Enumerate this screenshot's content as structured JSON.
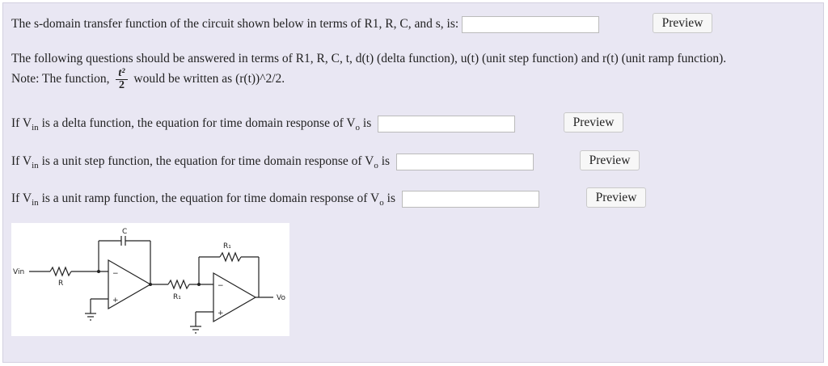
{
  "q1": {
    "text": "The s-domain transfer function of the circuit shown below in terms of R1, R, C, and s, is:",
    "preview": "Preview"
  },
  "instructions": {
    "line1": "The following questions should be answered in terms of R1, R, C, t, d(t) (delta function), u(t) (unit step function) and r(t) (unit ramp function).",
    "note_prefix": "Note: The function,",
    "frac_num": "t²",
    "frac_den": "2",
    "note_suffix": "would be written as (r(t))^2/2."
  },
  "q2": {
    "pre": "If V",
    "sub_in": "in",
    "mid": " is a delta function, the equation for time domain response of V",
    "sub_o": "o",
    "post": " is",
    "preview": "Preview"
  },
  "q3": {
    "pre": "If V",
    "sub_in": "in",
    "mid": " is a unit step function, the equation for time domain response of V",
    "sub_o": "o",
    "post": " is",
    "preview": "Preview"
  },
  "q4": {
    "pre": "If V",
    "sub_in": "in",
    "mid": " is a unit ramp function, the equation for time domain response of V",
    "sub_o": "o",
    "post": " is",
    "preview": "Preview"
  },
  "circuit": {
    "c_label": "C",
    "r1_top": "R₁",
    "vin": "Vin",
    "r_label": "R",
    "r1_mid": "R₁",
    "vo": "Vo",
    "minus": "−",
    "plus": "+"
  }
}
